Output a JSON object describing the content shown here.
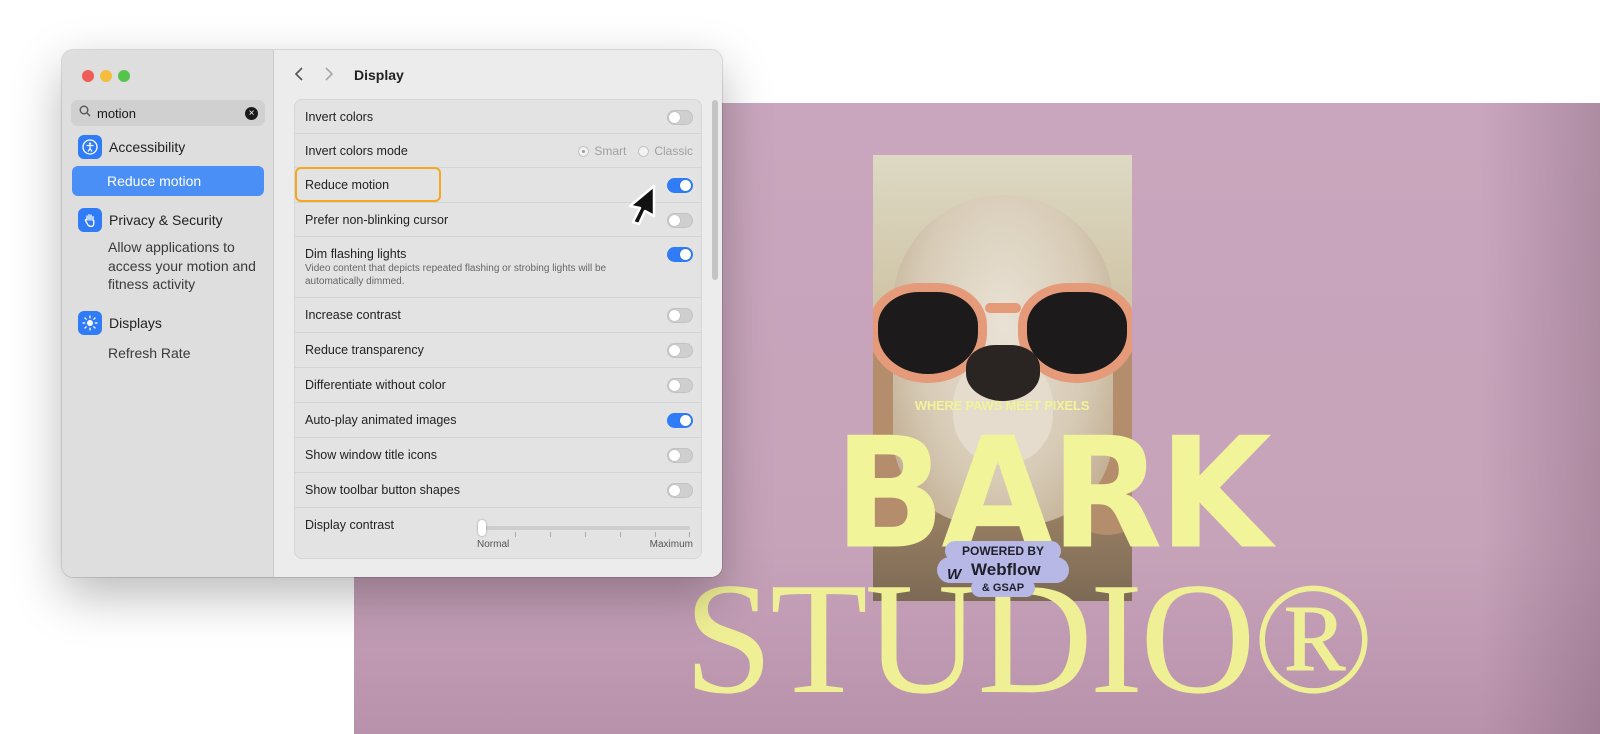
{
  "website": {
    "tagline": "WHERE PAWS MEET PIXELS",
    "headline": "BARK",
    "subheadline": "STUDIO®",
    "badge": {
      "top": "POWERED BY",
      "brand": "Webflow",
      "brand_icon": "W",
      "bottom": "& GSAP"
    }
  },
  "window": {
    "search": {
      "value": "motion",
      "placeholder": "Search"
    },
    "sidebar": {
      "accessibility": {
        "label": "Accessibility",
        "icon": "accessibility-icon"
      },
      "reduce_motion": {
        "label": "Reduce motion"
      },
      "privacy": {
        "label": "Privacy & Security",
        "icon": "hand-icon"
      },
      "privacy_sub": "Allow applications to access your motion and fitness activity",
      "displays": {
        "label": "Displays",
        "icon": "sun-icon"
      },
      "refresh_rate": {
        "label": "Refresh Rate"
      }
    },
    "title": "Display",
    "rows": [
      {
        "label": "Invert colors",
        "on": false
      },
      {
        "label": "Invert colors mode",
        "options": [
          "Smart",
          "Classic"
        ],
        "selected": "Smart"
      },
      {
        "label": "Reduce motion",
        "on": true
      },
      {
        "label": "Prefer non-blinking cursor",
        "on": false
      },
      {
        "label": "Dim flashing lights",
        "description": "Video content that depicts repeated flashing or strobing lights will be automatically dimmed.",
        "on": true
      },
      {
        "label": "Increase contrast",
        "on": false
      },
      {
        "label": "Reduce transparency",
        "on": false
      },
      {
        "label": "Differentiate without color",
        "on": false
      },
      {
        "label": "Auto-play animated images",
        "on": true
      },
      {
        "label": "Show window title icons",
        "on": false
      },
      {
        "label": "Show toolbar button shapes",
        "on": false
      },
      {
        "label": "Display contrast",
        "slider_min": "Normal",
        "slider_max": "Maximum",
        "value": 0
      }
    ]
  }
}
